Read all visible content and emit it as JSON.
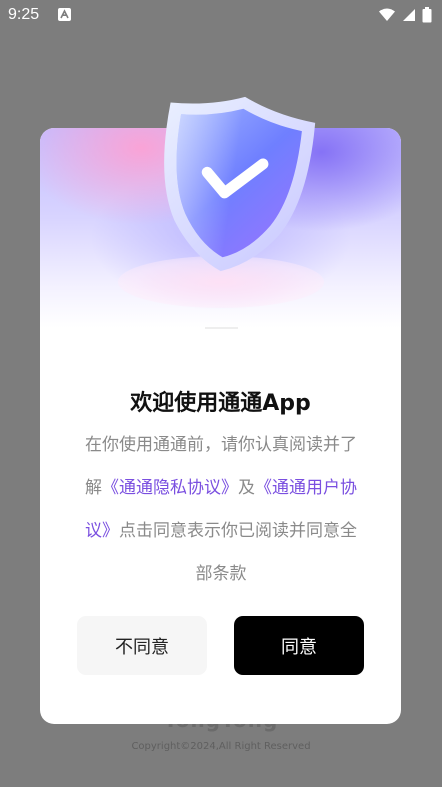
{
  "status_bar": {
    "time": "9:25"
  },
  "background": {
    "brand": "TongTong",
    "copyright": "Copyright©2024,All Right Reserved"
  },
  "dialog": {
    "title": "欢迎使用通通App",
    "body": {
      "text_1": "在你使用通通前，请你认真阅读并了解",
      "link_privacy": "《通通隐私协议》",
      "text_2": "及",
      "link_user": "《通通用户协议》",
      "text_3": "点击同意表示你已阅读并同意全部条款"
    },
    "buttons": {
      "disagree": "不同意",
      "agree": "同意"
    }
  },
  "colors": {
    "overlay": "#7d7d7d",
    "link": "#7a4fe0",
    "agree_button": "#000000",
    "disagree_button": "#f6f6f6"
  },
  "icons": {
    "shield": "shield-check-icon",
    "wifi": "wifi-icon",
    "signal": "signal-icon",
    "battery": "battery-icon",
    "notification": "notification-icon"
  }
}
